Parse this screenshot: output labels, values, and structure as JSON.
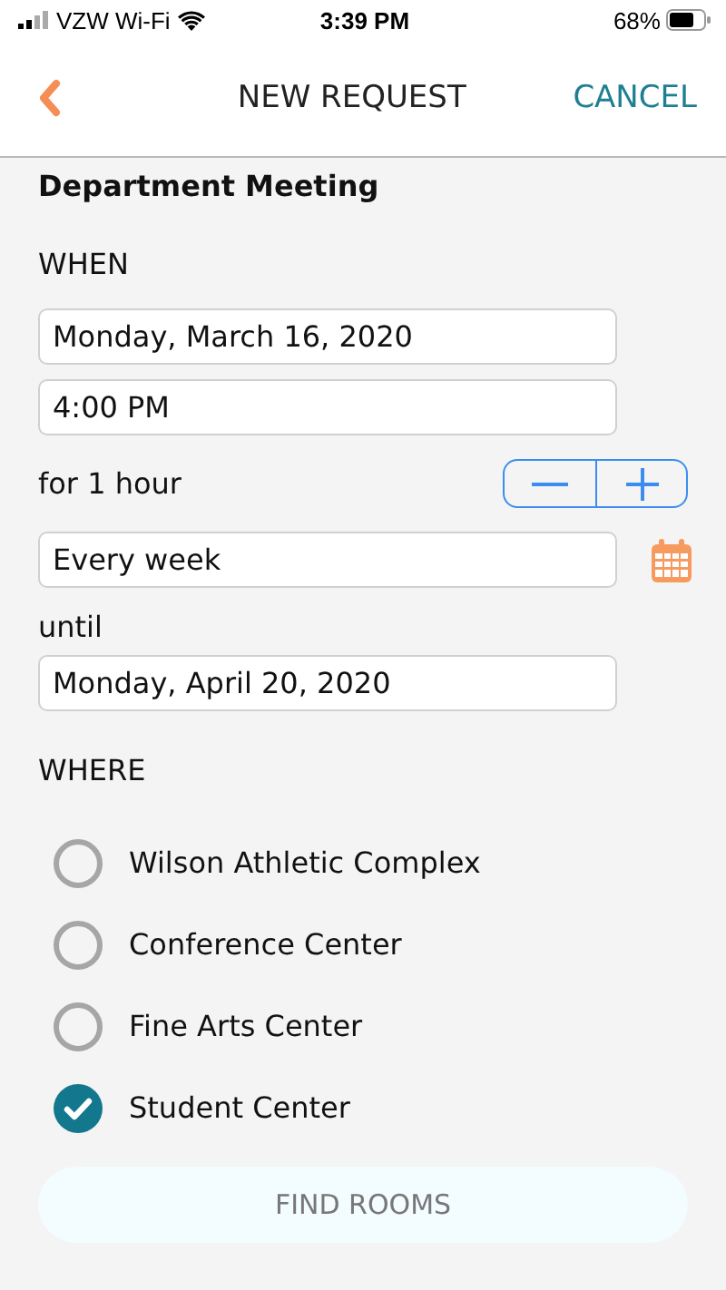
{
  "status_bar": {
    "carrier": "VZW Wi-Fi",
    "time": "3:39 PM",
    "battery": "68%"
  },
  "header": {
    "title": "NEW REQUEST",
    "cancel": "CANCEL"
  },
  "event_title": "Department Meeting",
  "when": {
    "label": "WHEN",
    "date": "Monday, March 16, 2020",
    "time": "4:00 PM",
    "duration": "for 1 hour",
    "repeat": "Every week",
    "until_label": "until",
    "until_date": "Monday, April 20, 2020"
  },
  "where": {
    "label": "WHERE",
    "options": [
      {
        "label": "Wilson Athletic Complex",
        "selected": false
      },
      {
        "label": "Conference Center",
        "selected": false
      },
      {
        "label": "Fine Arts Center",
        "selected": false
      },
      {
        "label": "Student Center",
        "selected": true
      }
    ]
  },
  "find_button": {
    "label": "FIND ROOMS",
    "disabled": true
  }
}
